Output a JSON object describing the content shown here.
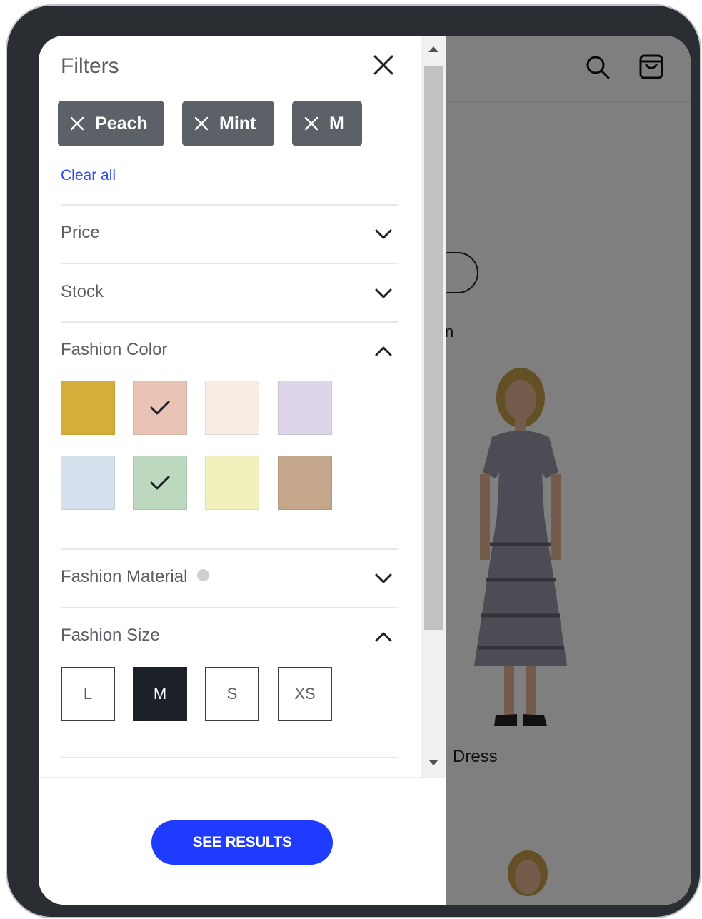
{
  "filters": {
    "title": "Filters",
    "active_chips": [
      {
        "label": "Peach"
      },
      {
        "label": "Mint"
      },
      {
        "label": "M"
      }
    ],
    "clear_all_label": "Clear all",
    "sections": {
      "price": {
        "label": "Price",
        "expanded": false
      },
      "stock": {
        "label": "Stock",
        "expanded": false
      },
      "color": {
        "label": "Fashion Color",
        "expanded": true
      },
      "material": {
        "label": "Fashion Material",
        "expanded": false,
        "icon": "info-icon"
      },
      "size": {
        "label": "Fashion Size",
        "expanded": true
      }
    },
    "color_swatches": [
      {
        "color": "#d4ad3a",
        "selected": false
      },
      {
        "color": "#e9c4b6",
        "selected": true
      },
      {
        "color": "#f9ece3",
        "selected": false
      },
      {
        "color": "#ddd6e8",
        "selected": false
      },
      {
        "color": "#d4e1ec",
        "selected": false
      },
      {
        "color": "#bcd8bf",
        "selected": true
      },
      {
        "color": "#f2f1be",
        "selected": false
      },
      {
        "color": "#c4a68a",
        "selected": false
      }
    ],
    "sizes": [
      {
        "label": "L",
        "selected": false
      },
      {
        "label": "M",
        "selected": true
      },
      {
        "label": "S",
        "selected": false
      },
      {
        "label": "XS",
        "selected": false
      }
    ],
    "see_results_label": "SEE RESULTS"
  },
  "background_page": {
    "fragment_text": "n",
    "product_name_fragment": "Dress",
    "header_icons": [
      "search-icon",
      "shopping-bag-icon"
    ]
  },
  "colors": {
    "accent": "#1f3bff",
    "link": "#2a46ff",
    "chip_bg": "#5b6167",
    "selected_size_bg": "#1b2127",
    "overlay": "rgba(0,0,0,0.5)"
  }
}
